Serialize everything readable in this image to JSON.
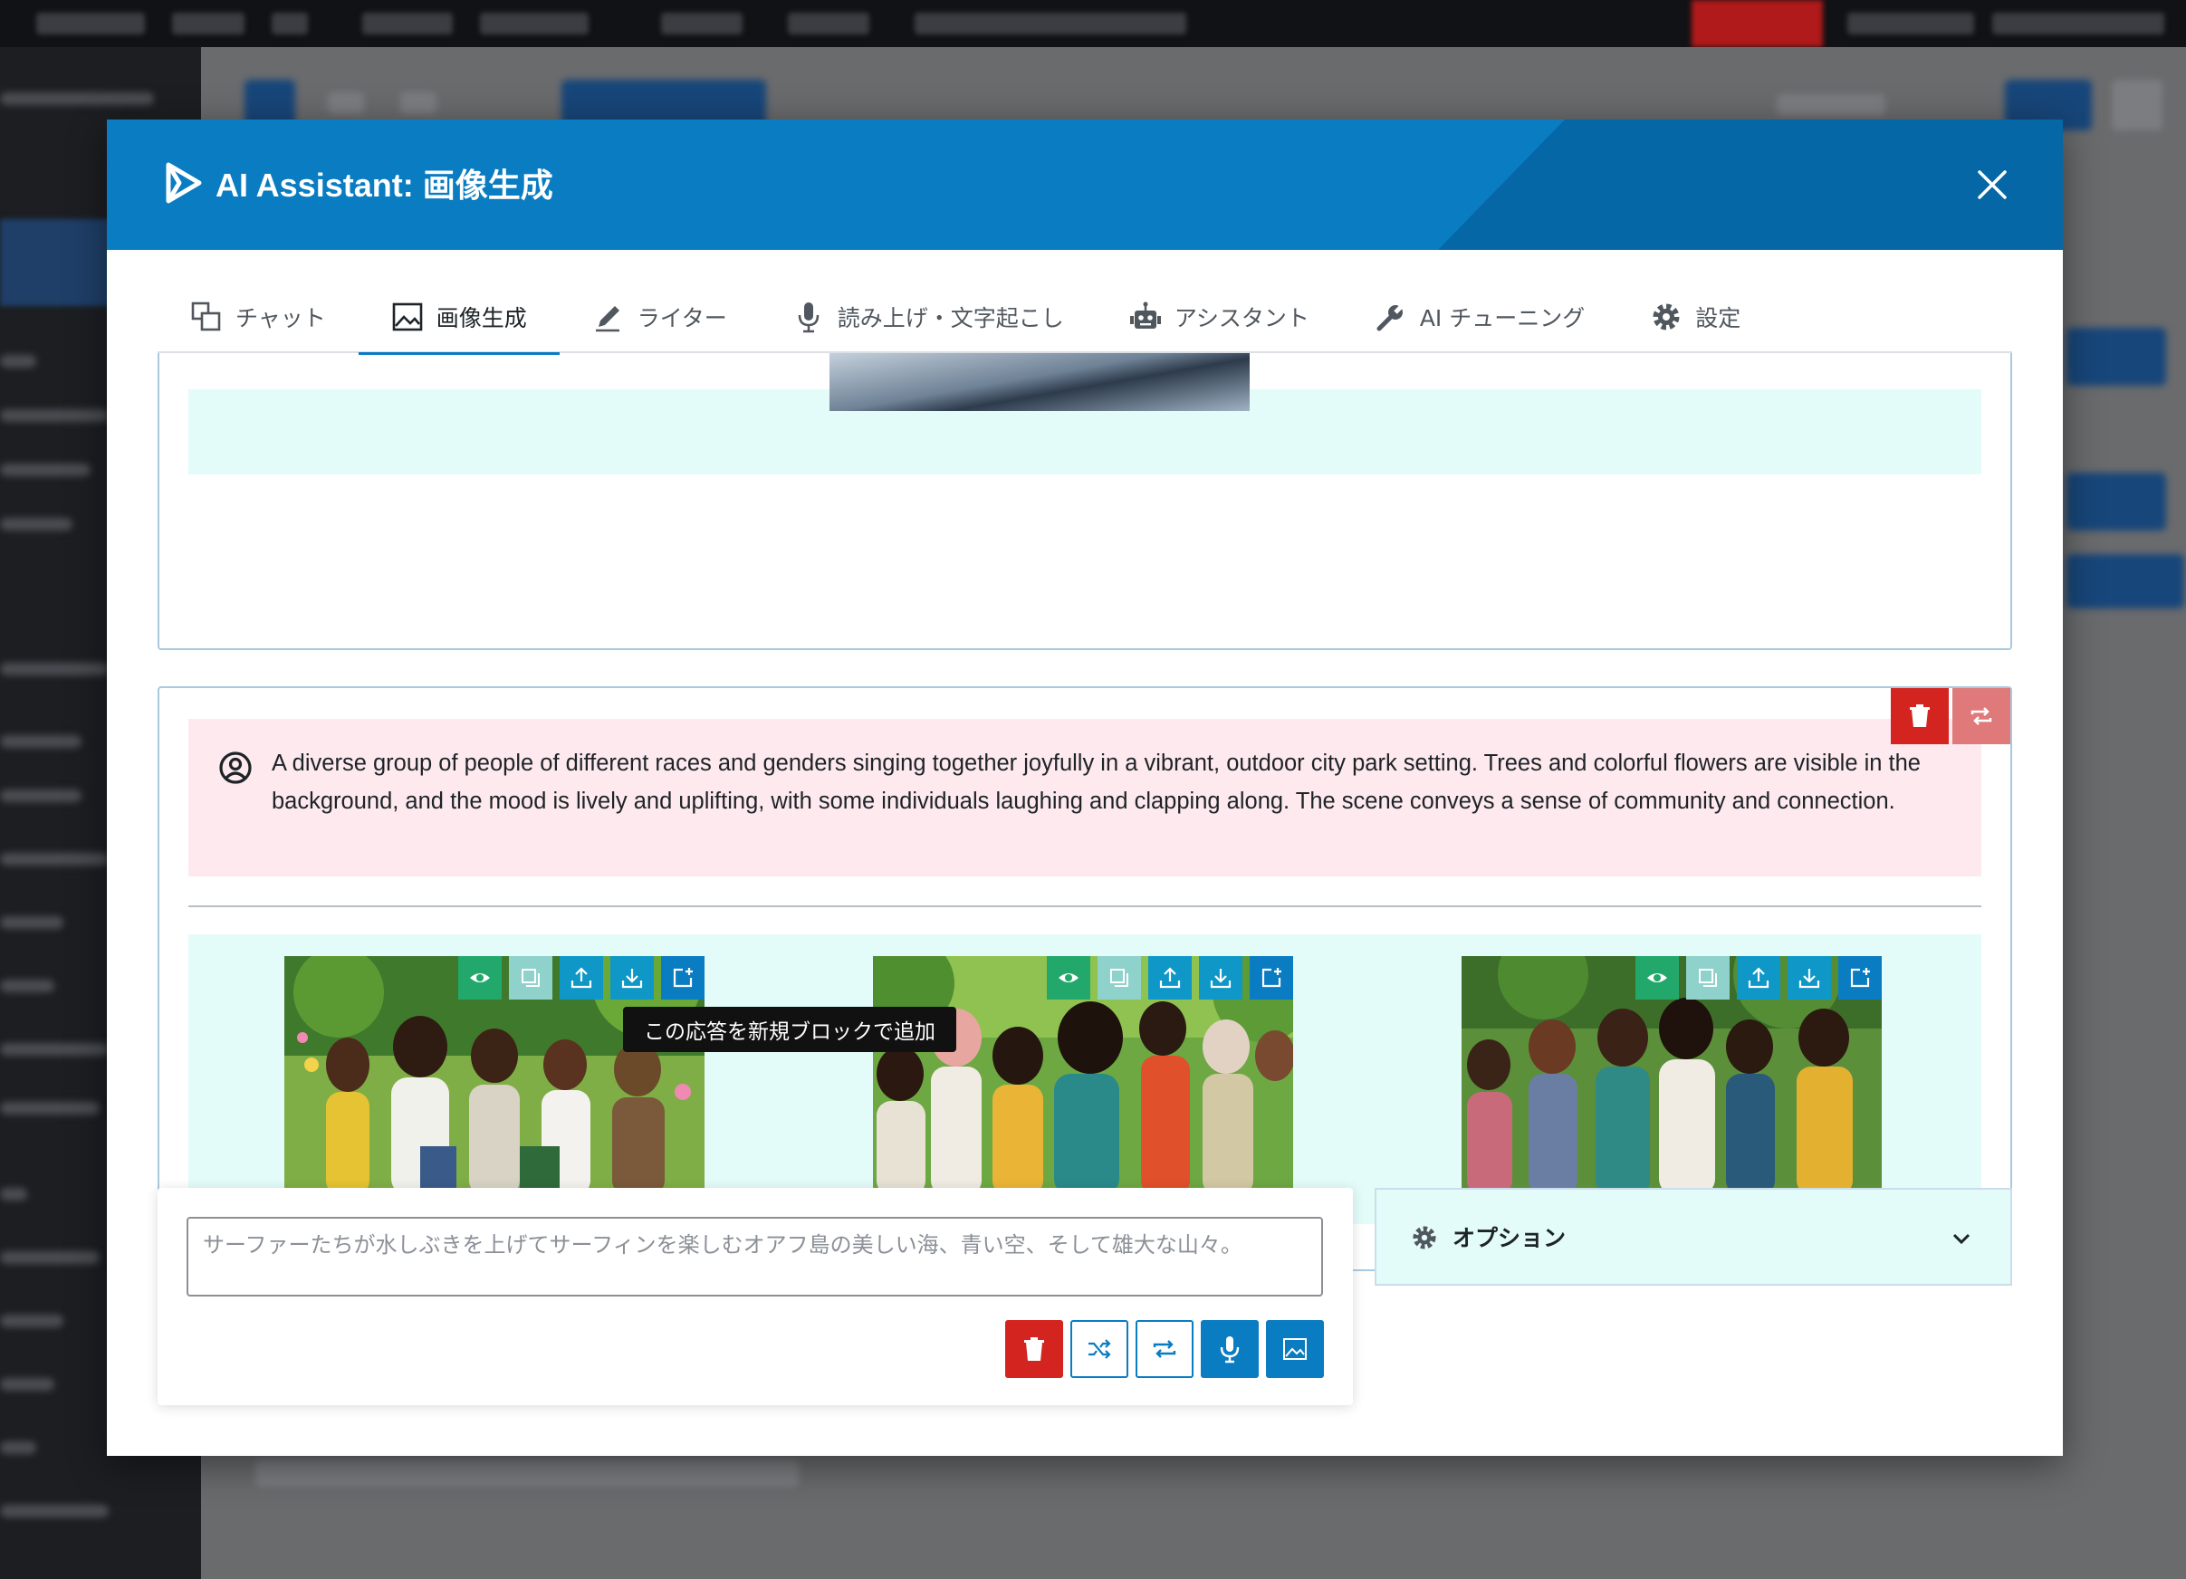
{
  "modal": {
    "title": "AI Assistant: 画像生成"
  },
  "tabs": [
    {
      "label": "チャット",
      "icon": "chat-icon"
    },
    {
      "label": "画像生成",
      "icon": "image-icon",
      "active": true
    },
    {
      "label": "ライター",
      "icon": "pencil-icon"
    },
    {
      "label": "読み上げ・文字起こし",
      "icon": "microphone-icon"
    },
    {
      "label": "アシスタント",
      "icon": "robot-icon"
    },
    {
      "label": "AI チューニング",
      "icon": "wrench-icon"
    },
    {
      "label": "設定",
      "icon": "gear-icon"
    }
  ],
  "conversation": {
    "prompt": "A diverse group of people of different races and genders singing together joyfully in a vibrant, outdoor city park setting. Trees and colorful flowers are visible in the background, and the mood is lively and uplifting, with some individuals laughing and clapping along. The scene conveys a sense of community and connection.",
    "generated_images": [
      {
        "alt": "generated-image-1"
      },
      {
        "alt": "generated-image-2"
      },
      {
        "alt": "generated-image-3"
      }
    ],
    "image_toolbar_icons": [
      "eye-icon",
      "copy-icon",
      "upload-icon",
      "download-icon",
      "add-block-icon"
    ],
    "tooltip": "この応答を新規ブロックで追加"
  },
  "input": {
    "placeholder": "サーファーたちが水しぶきを上げてサーフィンを楽しむオアフ島の美しい海、青い空、そして雄大な山々。"
  },
  "options": {
    "label": "オプション"
  },
  "colors": {
    "header": "#0a7cc1",
    "delete": "#d32420",
    "prompt_bg": "#fde9ee",
    "result_bg": "#e3fcfa"
  }
}
